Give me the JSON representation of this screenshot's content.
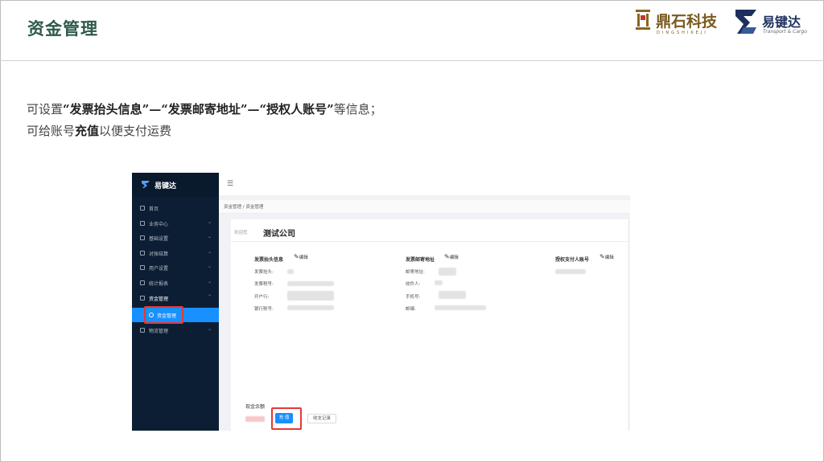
{
  "slide": {
    "title": "资金管理",
    "line1_parts": [
      "可设置",
      "“发票抬头信息”—“发票邮寄地址”—“授权人账号”",
      "等信息；"
    ],
    "line2_parts": [
      "可给账号",
      "充值",
      "以便支付运费"
    ]
  },
  "logos": {
    "dingshi": {
      "name": "鼎石科技",
      "sub": "DINGSHIKEJI"
    },
    "yijianda": {
      "name": "易键达",
      "sub": "Transport & Cargo"
    }
  },
  "app": {
    "brand": "易键达",
    "menu": [
      {
        "label": "首页",
        "arrow": ""
      },
      {
        "label": "业务中心",
        "arrow": "⌄"
      },
      {
        "label": "基础设置",
        "arrow": "⌄"
      },
      {
        "label": "对账结算",
        "arrow": "⌄"
      },
      {
        "label": "用户设置",
        "arrow": "⌄"
      },
      {
        "label": "统计报表",
        "arrow": "⌄"
      },
      {
        "label": "资金管理",
        "arrow": "⌃"
      },
      {
        "label": "物流管理",
        "arrow": "⌄"
      }
    ],
    "submenu_active": "资金管理",
    "breadcrumb": "资金管理 / 资金管理",
    "welcome_label": "欢迎您",
    "company": "测试公司",
    "invoice": {
      "title": "发票抬头信息",
      "edit": "编辑",
      "fields": [
        "发票抬头:",
        "发票税号:",
        "开户行:",
        "银行账号:"
      ]
    },
    "mailing": {
      "title": "发票邮寄地址",
      "edit": "编辑",
      "fields": [
        "邮寄地址:",
        "收件人:",
        "手机号:",
        "邮编:"
      ]
    },
    "authorized": {
      "title": "授权支付人账号",
      "edit": "编辑"
    },
    "balance_label": "现金余额",
    "recharge_label": "充 值",
    "record_label": "收支记录"
  }
}
